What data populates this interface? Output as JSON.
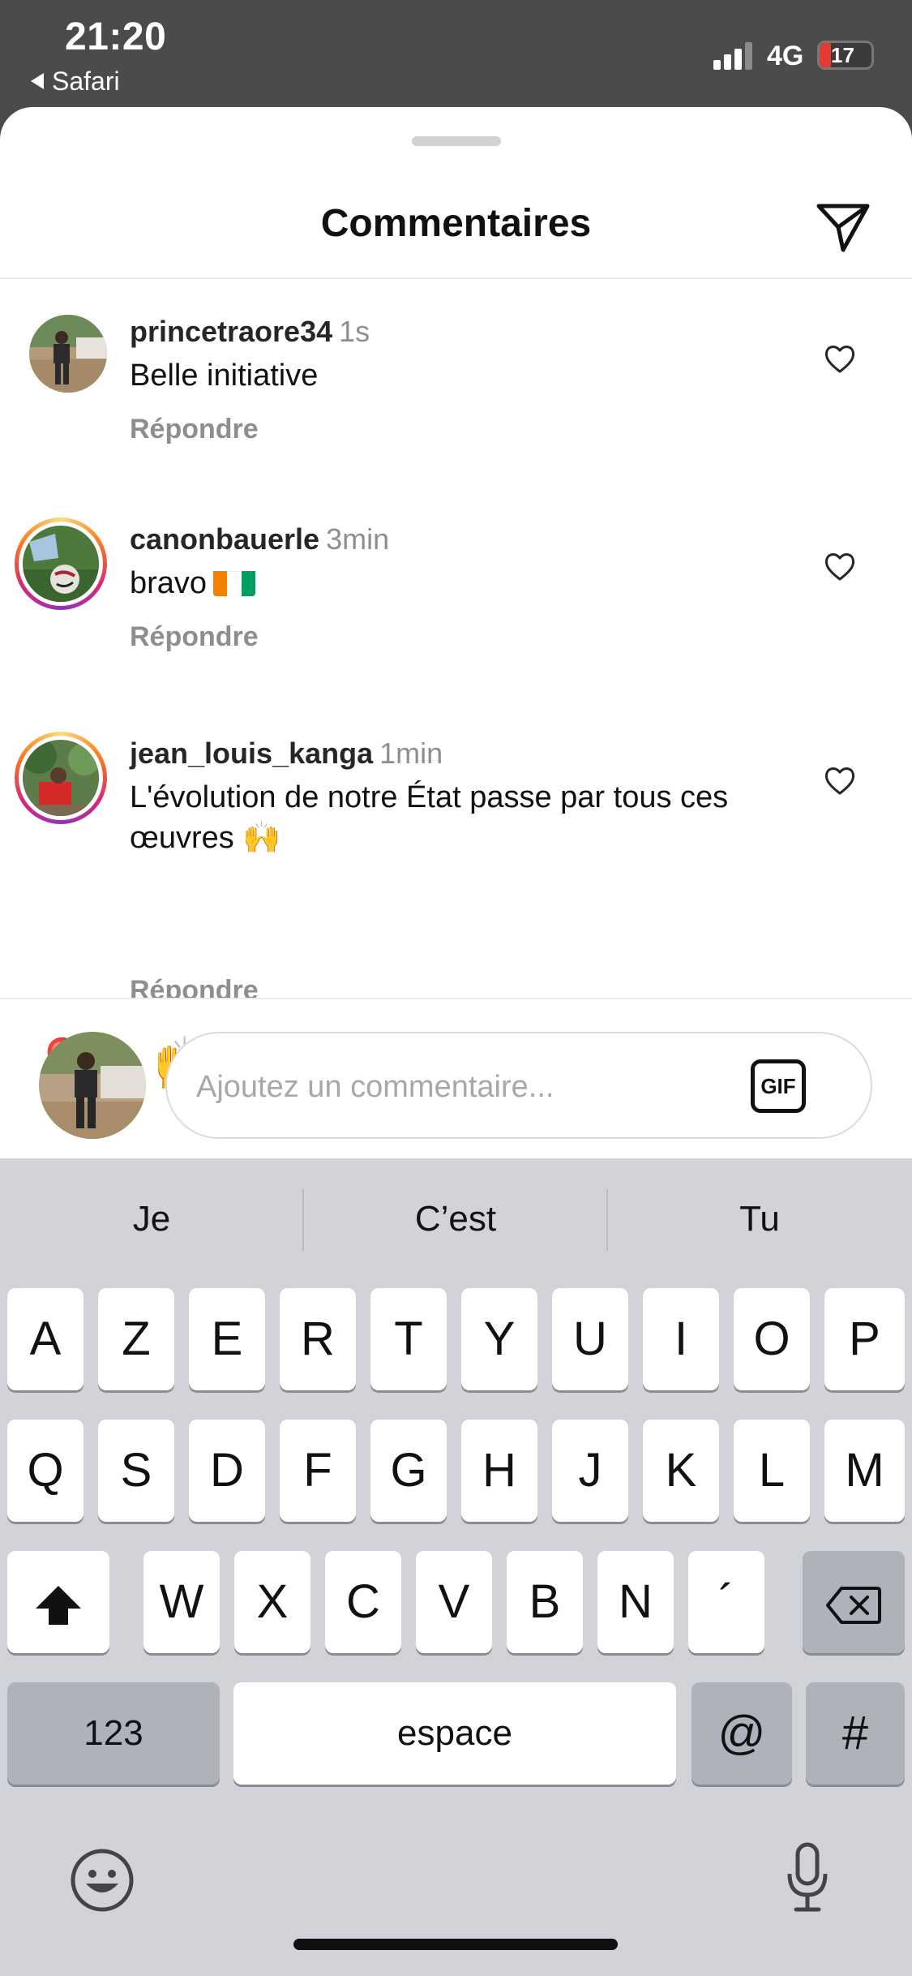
{
  "status_bar": {
    "time": "21:20",
    "back_app": "Safari",
    "network": "4G",
    "battery_level": "17"
  },
  "sheet": {
    "title": "Commentaires"
  },
  "comments": [
    {
      "username": "princetraore34",
      "time": "1s",
      "text": "Belle initiative",
      "reply": "Répondre"
    },
    {
      "username": "canonbauerle",
      "time": "3min",
      "text": "bravo",
      "reply": "Répondre"
    },
    {
      "username": "jean_louis_kanga",
      "time": "1min",
      "text": "L'évolution de notre État passe par tous ces œuvres 🙌",
      "reply": "Répondre"
    }
  ],
  "emoji_bar": [
    "❤️",
    "🙌",
    "🔥",
    "👏",
    "😢",
    "😍",
    "😮",
    "😂"
  ],
  "composer": {
    "placeholder": "Ajoutez un commentaire...",
    "gif_label": "GIF"
  },
  "keyboard": {
    "suggestions": [
      "Je",
      "C’est",
      "Tu"
    ],
    "row1": [
      "A",
      "Z",
      "E",
      "R",
      "T",
      "Y",
      "U",
      "I",
      "O",
      "P"
    ],
    "row2": [
      "Q",
      "S",
      "D",
      "F",
      "G",
      "H",
      "J",
      "K",
      "L",
      "M"
    ],
    "row3": [
      "W",
      "X",
      "C",
      "V",
      "B",
      "N",
      "´"
    ],
    "numbers_label": "123",
    "space_label": "espace",
    "at_label": "@",
    "hash_label": "#"
  }
}
